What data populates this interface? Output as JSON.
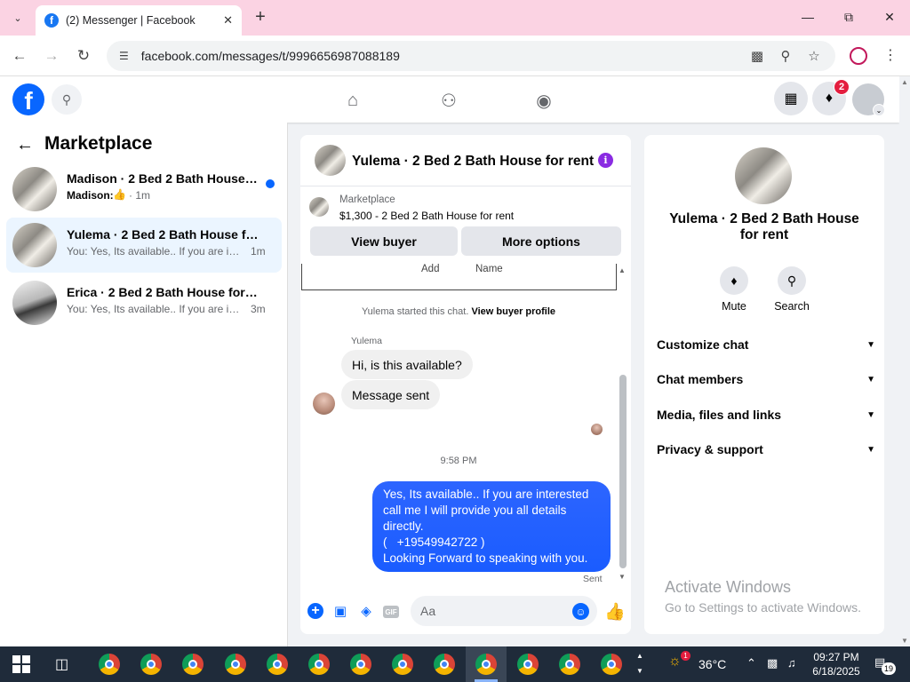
{
  "browser": {
    "tab_title": "(2) Messenger | Facebook",
    "tab_favicon": "facebook-favicon",
    "url": "facebook.com/messages/t/9996656987088189"
  },
  "fb_header": {
    "logo": "f",
    "notification_count": "2"
  },
  "left_panel": {
    "title": "Marketplace",
    "conversations": [
      {
        "name": "Madison · 2 Bed 2 Bath House fo...",
        "preview": "Madison:",
        "time": "· 1m",
        "unread": true
      },
      {
        "name": "Yulema · 2 Bed 2 Bath House for r...",
        "preview": "You: Yes, Its available.. If you are inter...",
        "time": "1m",
        "active": true
      },
      {
        "name": "Erica · 2 Bed 2 Bath House for rent",
        "preview": "You: Yes, Its available.. If you are inter...",
        "time": "3m"
      }
    ]
  },
  "chat": {
    "title": "Yulema · 2 Bed 2 Bath House for rent",
    "marketplace_label": "Marketplace",
    "listing": "$1,300 - 2 Bed 2 Bath House for rent",
    "view_buyer": "View buyer",
    "more_options": "More options",
    "form_add": "Add",
    "form_name": "Name",
    "started_text": "Yulema started this chat.",
    "view_profile": "View buyer profile",
    "sender_name": "Yulema",
    "msg_in_1": "Hi, is this available?",
    "msg_in_2": "Message sent",
    "time_label": "9:58 PM",
    "msg_out_lines": [
      "Yes, Its available.. If you are interested",
      "call me I will provide you all details",
      "directly.",
      "(   +19549942722 )",
      "Looking Forward to speaking with you."
    ],
    "sent_label": "Sent",
    "composer_placeholder": "Aa"
  },
  "right_panel": {
    "title": "Yulema · 2 Bed 2 Bath House for rent",
    "mute": "Mute",
    "search": "Search",
    "sections": [
      "Customize chat",
      "Chat members",
      "Media, files and links",
      "Privacy & support"
    ]
  },
  "watermark": {
    "line1": "Activate Windows",
    "line2": "Go to Settings to activate Windows."
  },
  "taskbar": {
    "temperature": "36°C",
    "time": "09:27 PM",
    "date": "6/18/2025",
    "notification_count": "19",
    "weather_badge": "1"
  }
}
